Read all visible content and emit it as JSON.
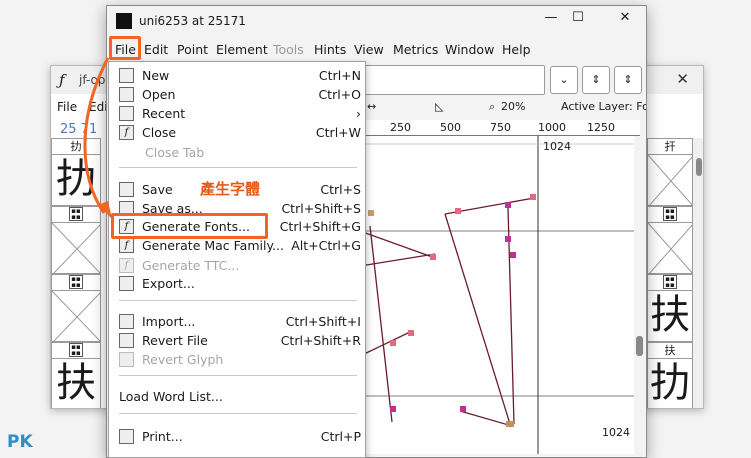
{
  "back_window": {
    "title": "jf-op",
    "menu": [
      "File",
      "Edit"
    ],
    "glyph_number": "25 71",
    "left_cells": [
      {
        "label": "扐",
        "char": "扐"
      },
      {
        "label": "",
        "char": ""
      },
      {
        "label": "",
        "char": ""
      },
      {
        "label": "",
        "char": "扶"
      }
    ],
    "right_cells": [
      {
        "label": "扞",
        "char": ""
      },
      {
        "label": "",
        "char": ""
      },
      {
        "label": "扶",
        "char": "扶"
      },
      {
        "label": "扐",
        "char": "扐"
      }
    ],
    "close_glyph": "✕"
  },
  "main_window": {
    "title": "uni6253 at 25171",
    "controls": {
      "minimize": "—",
      "maximize": "☐",
      "close": "✕"
    },
    "menu": [
      "File",
      "Edit",
      "Point",
      "Element",
      "Tools",
      "Hints",
      "View",
      "Metrics",
      "Window",
      "Help"
    ],
    "toolbar": {
      "dropdown_glyph": "⌄",
      "up_down_glyph": "⇕"
    },
    "status": {
      "zoom": "20%",
      "active_layer": "Active Layer: Fore"
    },
    "ruler": [
      "250",
      "500",
      "750",
      "1000",
      "1250"
    ],
    "canvas_labels": {
      "top": "1024",
      "bottom": "1024"
    }
  },
  "file_menu": {
    "items": [
      {
        "label": "New",
        "key": "Ctrl+N",
        "icon": "new-file-icon",
        "disabled": false
      },
      {
        "label": "Open",
        "key": "Ctrl+O",
        "icon": "open-folder-icon",
        "disabled": false
      },
      {
        "label": "Recent",
        "key": "›",
        "icon": "recent-icon",
        "disabled": false
      },
      {
        "label": "Close",
        "key": "Ctrl+W",
        "icon": "close-file-icon",
        "disabled": false
      },
      {
        "label": "Close Tab",
        "key": "",
        "icon": "",
        "disabled": true
      },
      {
        "label": "Save",
        "key": "Ctrl+S",
        "icon": "save-icon",
        "disabled": false
      },
      {
        "label": "Save as...",
        "key": "Ctrl+Shift+S",
        "icon": "save-as-icon",
        "disabled": false
      },
      {
        "label": "Generate Fonts...",
        "key": "Ctrl+Shift+G",
        "icon": "generate-fonts-icon",
        "disabled": false
      },
      {
        "label": "Generate Mac Family...",
        "key": "Alt+Ctrl+G",
        "icon": "generate-mac-icon",
        "disabled": false
      },
      {
        "label": "Generate TTC...",
        "key": "",
        "icon": "generate-ttc-icon",
        "disabled": true
      },
      {
        "label": "Export...",
        "key": "",
        "icon": "export-icon",
        "disabled": false
      },
      {
        "label": "Import...",
        "key": "Ctrl+Shift+I",
        "icon": "import-icon",
        "disabled": false
      },
      {
        "label": "Revert File",
        "key": "Ctrl+Shift+R",
        "icon": "revert-icon",
        "disabled": false
      },
      {
        "label": "Revert Glyph",
        "key": "",
        "icon": "revert-glyph-icon",
        "disabled": true
      },
      {
        "label": "Load Word List...",
        "key": "",
        "icon": "",
        "disabled": false
      },
      {
        "label": "Print...",
        "key": "Ctrl+P",
        "icon": "print-icon",
        "disabled": false
      }
    ]
  },
  "annotation": {
    "callout": "產生字體",
    "color": "#f26522"
  },
  "watermark": "PK"
}
